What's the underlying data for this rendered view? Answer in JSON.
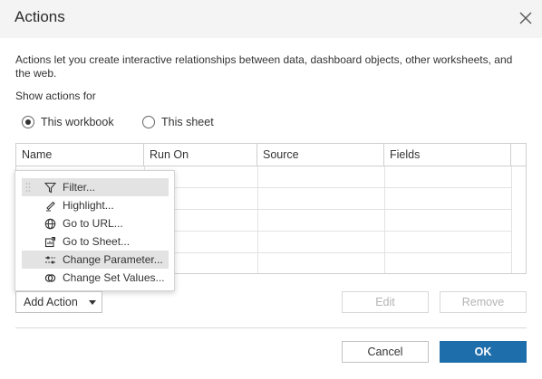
{
  "dialog": {
    "title": "Actions",
    "description": "Actions let you create interactive relationships between data, dashboard objects, other worksheets, and the web.",
    "show_actions_label": "Show actions for"
  },
  "scope": {
    "options": [
      "This workbook",
      "This sheet"
    ],
    "selected": "This workbook"
  },
  "table": {
    "columns": [
      "Name",
      "Run On",
      "Source",
      "Fields"
    ],
    "rows": []
  },
  "add_action_menu": {
    "items": [
      "Filter...",
      "Highlight...",
      "Go to URL...",
      "Go to Sheet...",
      "Change Parameter...",
      "Change Set Values..."
    ],
    "icons": [
      "filter-icon",
      "highlight-icon",
      "globe-icon",
      "go-to-sheet-icon",
      "change-parameter-icon",
      "change-set-values-icon"
    ],
    "hovered": "Filter..."
  },
  "buttons": {
    "add_action": "Add Action",
    "edit": "Edit",
    "remove": "Remove",
    "cancel": "Cancel",
    "ok": "OK"
  },
  "colors": {
    "accent": "#1f6eac",
    "titlebar_bg": "#f4f4f4",
    "hover_bg": "#e3e3e3"
  }
}
